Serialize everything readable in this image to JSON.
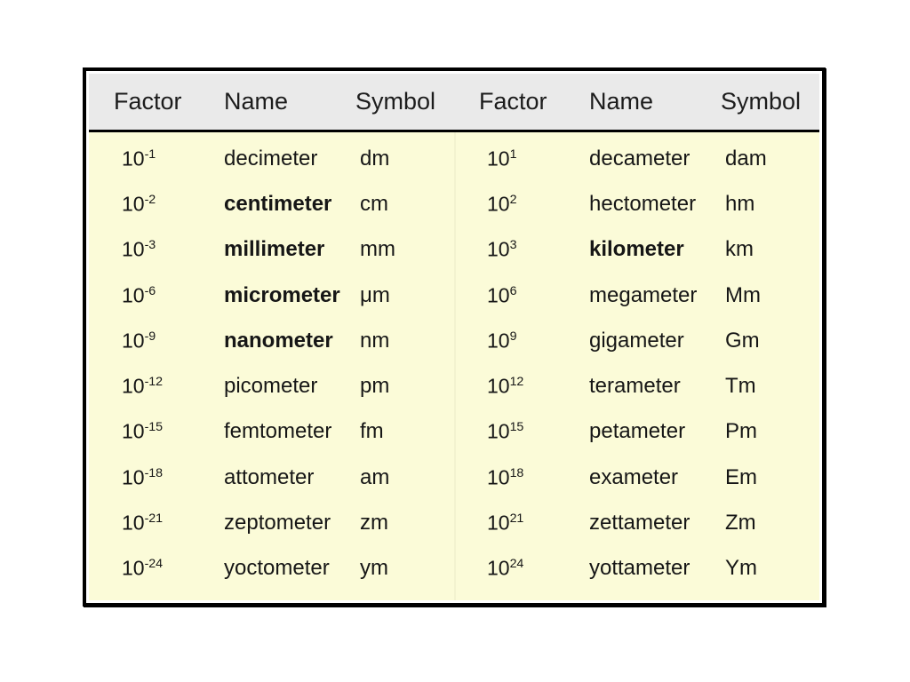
{
  "table": {
    "headers": {
      "factor": "Factor",
      "name": "Name",
      "symbol": "Symbol"
    },
    "colors": {
      "header_background": "#eaeaea",
      "body_background": "#fbfbd8",
      "border": "#000000",
      "text": "#161616",
      "page_background": "#ffffff"
    },
    "left_column": [
      {
        "base": "10",
        "exponent": "-1",
        "factor": "10-1",
        "name": "decimeter",
        "symbol": "dm",
        "bold": false
      },
      {
        "base": "10",
        "exponent": "-2",
        "factor": "10-2",
        "name": "centimeter",
        "symbol": "cm",
        "bold": true
      },
      {
        "base": "10",
        "exponent": "-3",
        "factor": "10-3",
        "name": "millimeter",
        "symbol": "mm",
        "bold": true
      },
      {
        "base": "10",
        "exponent": "-6",
        "factor": "10-6",
        "name": "micrometer",
        "symbol": "μm",
        "bold": true
      },
      {
        "base": "10",
        "exponent": "-9",
        "factor": "10-9",
        "name": "nanometer",
        "symbol": "nm",
        "bold": true
      },
      {
        "base": "10",
        "exponent": "-12",
        "factor": "10-12",
        "name": "picometer",
        "symbol": "pm",
        "bold": false
      },
      {
        "base": "10",
        "exponent": "-15",
        "factor": "10-15",
        "name": "femtometer",
        "symbol": "fm",
        "bold": false
      },
      {
        "base": "10",
        "exponent": "-18",
        "factor": "10-18",
        "name": "attometer",
        "symbol": "am",
        "bold": false
      },
      {
        "base": "10",
        "exponent": "-21",
        "factor": "10-21",
        "name": "zeptometer",
        "symbol": "zm",
        "bold": false
      },
      {
        "base": "10",
        "exponent": "-24",
        "factor": "10-24",
        "name": "yoctometer",
        "symbol": "ym",
        "bold": false
      }
    ],
    "right_column": [
      {
        "base": "10",
        "exponent": "1",
        "factor": "101",
        "name": "decameter",
        "symbol": "dam",
        "bold": false
      },
      {
        "base": "10",
        "exponent": "2",
        "factor": "102",
        "name": "hectometer",
        "symbol": "hm",
        "bold": false
      },
      {
        "base": "10",
        "exponent": "3",
        "factor": "103",
        "name": "kilometer",
        "symbol": "km",
        "bold": true
      },
      {
        "base": "10",
        "exponent": "6",
        "factor": "106",
        "name": "megameter",
        "symbol": "Mm",
        "bold": false
      },
      {
        "base": "10",
        "exponent": "9",
        "factor": "109",
        "name": "gigameter",
        "symbol": "Gm",
        "bold": false
      },
      {
        "base": "10",
        "exponent": "12",
        "factor": "1012",
        "name": "terameter",
        "symbol": "Tm",
        "bold": false
      },
      {
        "base": "10",
        "exponent": "15",
        "factor": "1015",
        "name": "petameter",
        "symbol": "Pm",
        "bold": false
      },
      {
        "base": "10",
        "exponent": "18",
        "factor": "1018",
        "name": "exameter",
        "symbol": "Em",
        "bold": false
      },
      {
        "base": "10",
        "exponent": "21",
        "factor": "1021",
        "name": "zettameter",
        "symbol": "Zm",
        "bold": false
      },
      {
        "base": "10",
        "exponent": "24",
        "factor": "1024",
        "name": "yottameter",
        "symbol": "Ym",
        "bold": false
      }
    ]
  }
}
